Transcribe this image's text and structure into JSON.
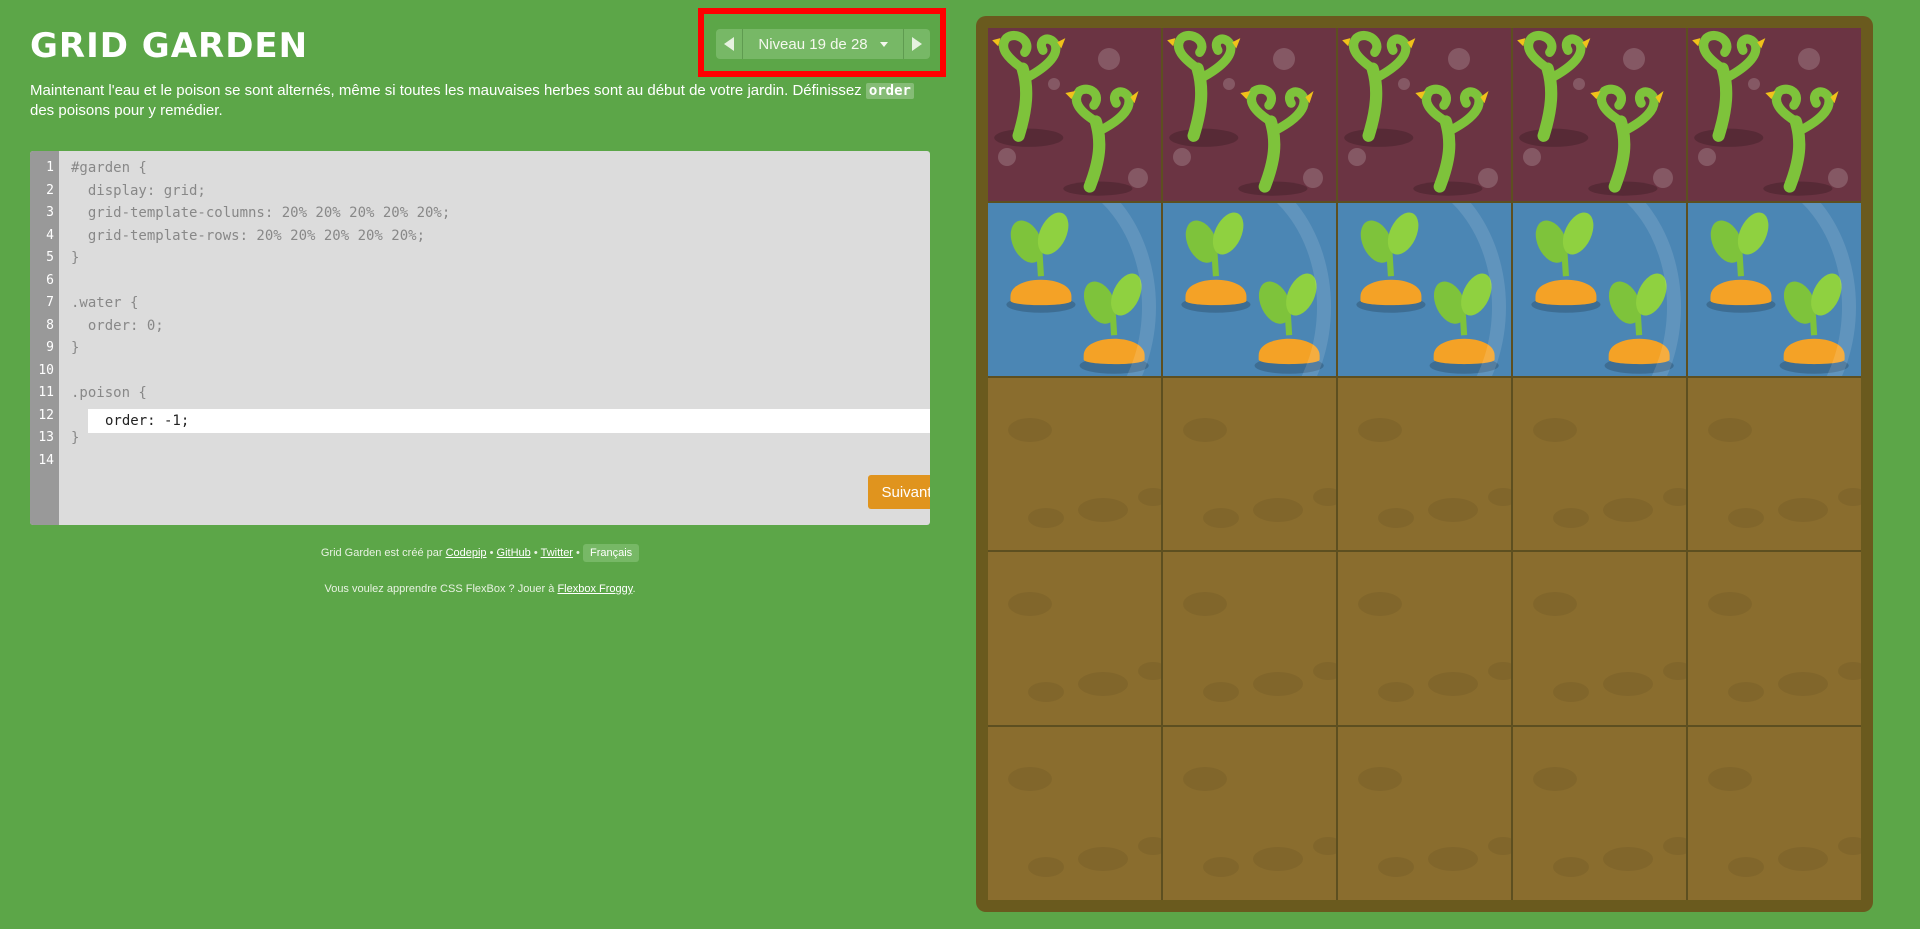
{
  "app": {
    "title": "GRID GARDEN"
  },
  "level_nav": {
    "label": "Niveau 19 de 28"
  },
  "instructions": {
    "text_before": "Maintenant l'eau et le poison se sont alternés, même si toutes les mauvaises herbes sont au début de votre jardin. Définissez ",
    "code": "order",
    "text_after": " des poisons pour y remédier."
  },
  "editor": {
    "line_numbers": [
      "1",
      "2",
      "3",
      "4",
      "5",
      "6",
      "7",
      "8",
      "9",
      "10",
      "11",
      "12",
      "13",
      "14"
    ],
    "lines": [
      "#garden {",
      "  display: grid;",
      "  grid-template-columns: 20% 20% 20% 20% 20%;",
      "  grid-template-rows: 20% 20% 20% 20% 20%;",
      "}",
      "",
      ".water {",
      "  order: 0;",
      "}",
      "",
      ".poison {",
      "",
      "}",
      ""
    ],
    "input_value": "order: -1;",
    "next_button_label": "Suivant"
  },
  "footer": {
    "credit_prefix": "Grid Garden est créé par",
    "link_codepip": "Codepip",
    "sep1": "•",
    "link_github": "GitHub",
    "sep2": "•",
    "link_twitter": "Twitter",
    "sep3": "•",
    "language_button": "Français",
    "flexbox_prefix": "Vous voulez apprendre CSS FlexBox ? Jouer à",
    "link_flexbox": "Flexbox Froggy",
    "flexbox_suffix": "."
  },
  "garden": {
    "rows": [
      "poison",
      "water",
      "dirt",
      "dirt",
      "dirt"
    ],
    "columns": 5
  },
  "colors": {
    "background": "#5ca648",
    "highlight": "#ff0000",
    "button": "#e0941e",
    "poison_cell": "#6b3443",
    "water_cell": "#4b86b4",
    "dirt_cell": "#8a6d2e"
  }
}
